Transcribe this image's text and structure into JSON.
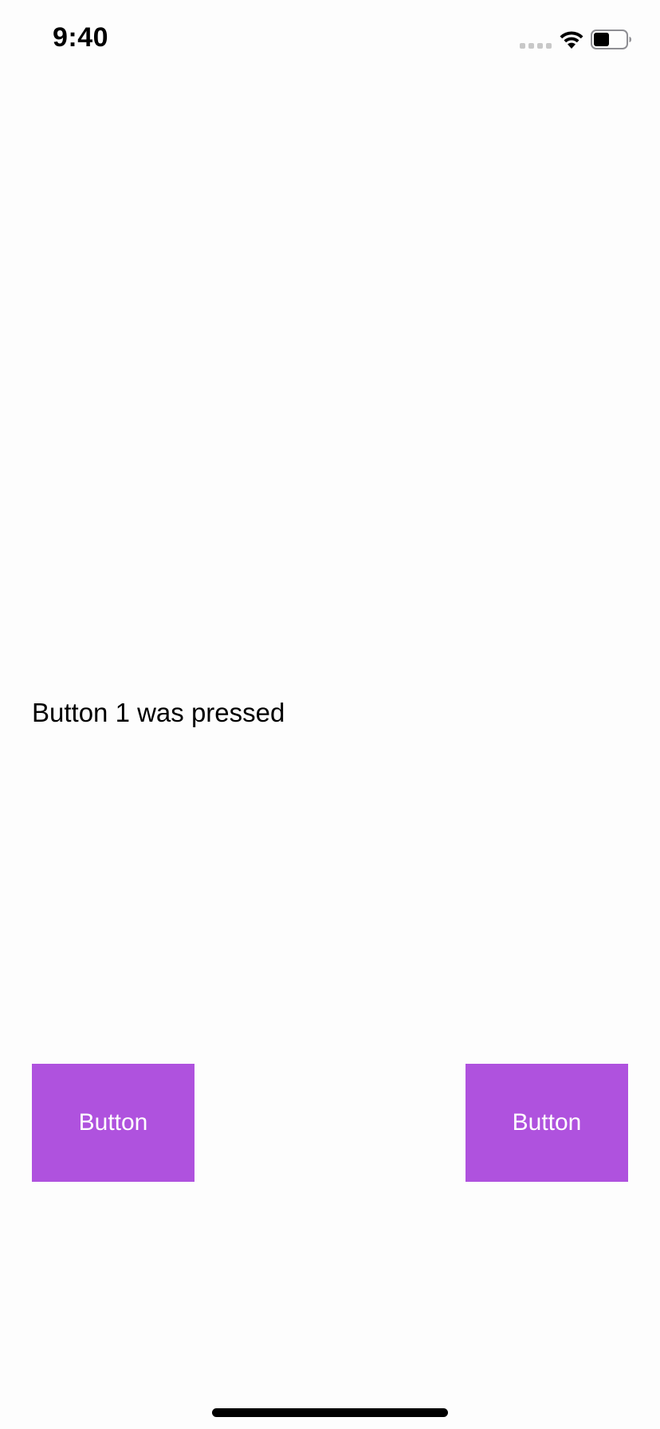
{
  "status_bar": {
    "time": "9:40",
    "icons": [
      "cellular-signal-icon",
      "wifi-icon",
      "battery-icon"
    ]
  },
  "main": {
    "message": "Button 1 was pressed"
  },
  "buttons": {
    "left_label": "Button",
    "right_label": "Button",
    "color": "#af52de",
    "text_color": "#ffffff"
  }
}
